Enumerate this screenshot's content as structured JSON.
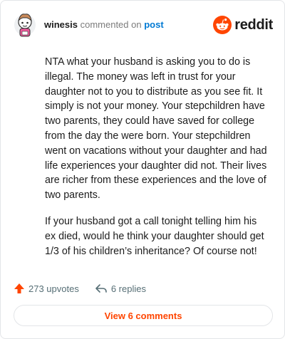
{
  "comment": {
    "username": "winesis",
    "action_text": "commented on",
    "post_link": "post",
    "paragraphs": [
      "NTA what your husband is asking you to do is illegal. The money was left in trust for your daughter not to you to distribute as you see fit. It simply is not your money. Your stepchildren have two parents, they could have saved for college from the day the were born. Your stepchildren went on vacations without your daughter and had life experiences your daughter did not. Their lives are richer from these experiences and the love of two parents.",
      "If your husband got a call tonight telling him his ex died, would he think your daughter should get 1/3 of his children’s inheritance? Of course not!"
    ]
  },
  "brand": {
    "name": "reddit",
    "color": "#ff4500",
    "icon": "reddit-alien-icon"
  },
  "actions": {
    "upvotes": "273 upvotes",
    "upvote_icon": "upvote-arrow-icon",
    "upvote_color": "#ff4500",
    "replies": "6 replies",
    "reply_icon": "reply-arrow-icon"
  },
  "view_button": {
    "label": "View 6 comments",
    "color": "#ff4500"
  }
}
